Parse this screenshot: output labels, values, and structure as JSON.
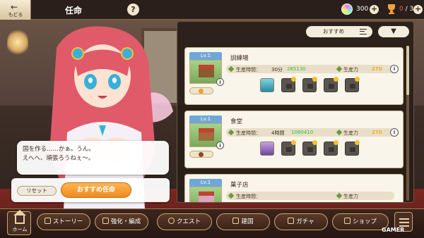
{
  "header": {
    "back_label": "もどる",
    "title": "任命",
    "help": "?",
    "gems": "300",
    "trophy_current": "0",
    "trophy_sep": "/",
    "trophy_total": "3"
  },
  "dialogue": {
    "line1": "国を作る……かぁ。うん。",
    "line2": "えへへ、頑張ろうねぇ〜。",
    "reset_label": "リセット",
    "recommend_label": "おすすめ任命"
  },
  "panel": {
    "sort_label": "おすすめ",
    "cards": [
      {
        "level": "Lv.1",
        "name": "訓練場",
        "stat1_label": "生産時間：",
        "stat1_value": "30分",
        "stat1_green": "265130",
        "stat2_label": "生産力",
        "stat2_value": "270"
      },
      {
        "level": "Lv.1",
        "name": "食堂",
        "stat1_label": "生産時間：",
        "stat1_value": "4時間",
        "stat1_green": "1080410",
        "stat2_label": "生産力",
        "stat2_value": "270"
      },
      {
        "level": "Lv.1",
        "name": "菓子店",
        "stat1_label": "生産時間：",
        "stat1_value": "",
        "stat1_green": "",
        "stat2_label": "生産力",
        "stat2_value": ""
      }
    ]
  },
  "nav": {
    "home": "ホーム",
    "story": "ストーリー",
    "enhance": "強化・編成",
    "quest": "クエスト",
    "build": "建国",
    "gacha": "ガチャ",
    "shop": "ショップ"
  },
  "watermark": "GAMER",
  "colors": {
    "accent": "#f08a1e",
    "level_tag": "#6fa8d6",
    "stat_green": "#2fbe3a",
    "stat_yellow": "#e8b020"
  }
}
